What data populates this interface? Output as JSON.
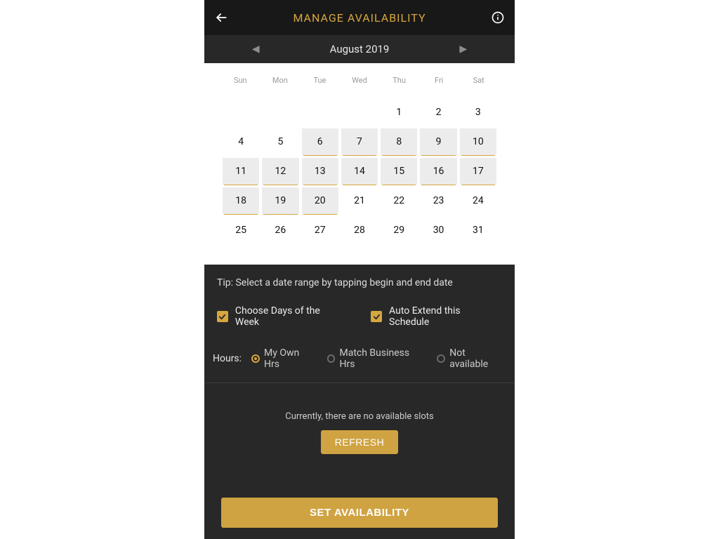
{
  "header": {
    "title": "MANAGE AVAILABILITY"
  },
  "month": {
    "label": "August 2019"
  },
  "weekdays": [
    "Sun",
    "Mon",
    "Tue",
    "Wed",
    "Thu",
    "Fri",
    "Sat"
  ],
  "calendar": {
    "leading_blanks": 4,
    "days": [
      {
        "n": "1",
        "sel": false,
        "gold": false
      },
      {
        "n": "2",
        "sel": false,
        "gold": false
      },
      {
        "n": "3",
        "sel": false,
        "gold": false
      },
      {
        "n": "4",
        "sel": false,
        "gold": false
      },
      {
        "n": "5",
        "sel": false,
        "gold": false
      },
      {
        "n": "6",
        "sel": true,
        "gold": true
      },
      {
        "n": "7",
        "sel": true,
        "gold": true
      },
      {
        "n": "8",
        "sel": true,
        "gold": true
      },
      {
        "n": "9",
        "sel": true,
        "gold": true
      },
      {
        "n": "10",
        "sel": true,
        "gold": true
      },
      {
        "n": "11",
        "sel": true,
        "gold": true
      },
      {
        "n": "12",
        "sel": true,
        "gold": true
      },
      {
        "n": "13",
        "sel": true,
        "gold": true
      },
      {
        "n": "14",
        "sel": true,
        "gold": true
      },
      {
        "n": "15",
        "sel": true,
        "gold": true
      },
      {
        "n": "16",
        "sel": true,
        "gold": true
      },
      {
        "n": "17",
        "sel": true,
        "gold": true
      },
      {
        "n": "18",
        "sel": true,
        "gold": true
      },
      {
        "n": "19",
        "sel": true,
        "gold": true
      },
      {
        "n": "20",
        "sel": true,
        "gold": true
      },
      {
        "n": "21",
        "sel": false,
        "gold": false
      },
      {
        "n": "22",
        "sel": false,
        "gold": false
      },
      {
        "n": "23",
        "sel": false,
        "gold": false
      },
      {
        "n": "24",
        "sel": false,
        "gold": false
      },
      {
        "n": "25",
        "sel": false,
        "gold": false
      },
      {
        "n": "26",
        "sel": false,
        "gold": false
      },
      {
        "n": "27",
        "sel": false,
        "gold": false
      },
      {
        "n": "28",
        "sel": false,
        "gold": false
      },
      {
        "n": "29",
        "sel": false,
        "gold": false
      },
      {
        "n": "30",
        "sel": false,
        "gold": false
      },
      {
        "n": "31",
        "sel": false,
        "gold": false
      }
    ]
  },
  "tip": "Tip: Select a date range by tapping begin and end date",
  "checks": {
    "choose_days": "Choose Days of the Week",
    "auto_extend": "Auto Extend this Schedule"
  },
  "hours": {
    "label": "Hours:",
    "options": [
      {
        "label": "My Own Hrs",
        "selected": true
      },
      {
        "label": "Match Business Hrs",
        "selected": false
      },
      {
        "label": "Not available",
        "selected": false
      }
    ]
  },
  "slots": {
    "empty_text": "Currently, there are no available slots",
    "refresh": "REFRESH"
  },
  "set_button": "SET AVAILABILITY"
}
